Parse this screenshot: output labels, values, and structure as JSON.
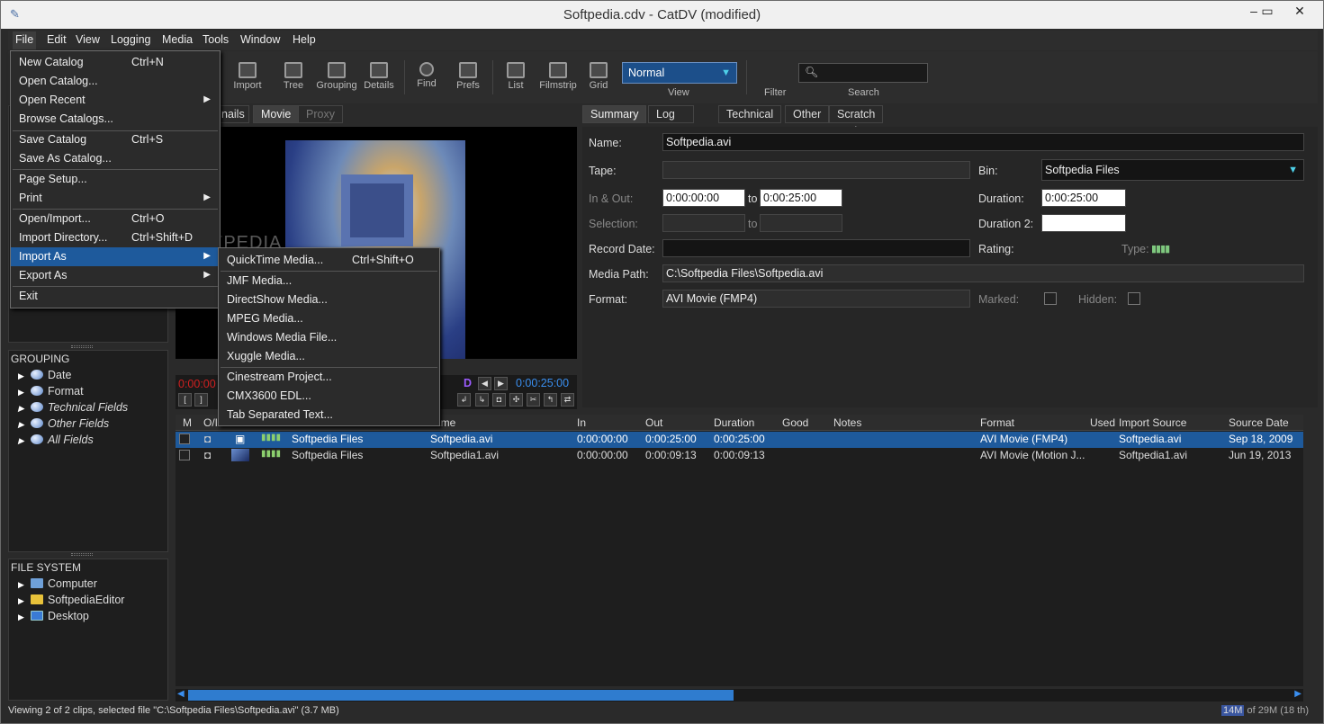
{
  "window": {
    "title": "Softpedia.cdv - CatDV (modified)"
  },
  "menubar": [
    "File",
    "Edit",
    "View",
    "Logging",
    "Media",
    "Tools",
    "Window",
    "Help"
  ],
  "toolbar": {
    "buttons": [
      "Import",
      "Tree",
      "Grouping",
      "Details",
      "Find",
      "Prefs",
      "List",
      "Filmstrip",
      "Grid"
    ],
    "view_label": "View",
    "view_value": "Normal",
    "filter_label": "Filter",
    "search_label": "Search"
  },
  "left": {
    "grouping_header": "GROUPING",
    "grouping_items": [
      "Date",
      "Format",
      "Technical Fields",
      "Other Fields",
      "All Fields"
    ],
    "fs_header": "FILE SYSTEM",
    "fs_items": [
      "Computer",
      "SoftpediaEditor",
      "Desktop"
    ]
  },
  "player": {
    "tabs": [
      "nails",
      "Movie",
      "Proxy"
    ],
    "tc_in": "0:00:00",
    "tc_out": "0:00:25:00",
    "d_mark": "D"
  },
  "details": {
    "tabs": [
      "Summary",
      "Log Notes",
      "Technical",
      "Other",
      "Scratch Pad"
    ],
    "name_label": "Name:",
    "name_value": "Softpedia.avi",
    "tape_label": "Tape:",
    "bin_label": "Bin:",
    "bin_value": "Softpedia Files",
    "inout_label": "In & Out:",
    "in_value": "0:00:00:00",
    "to1": "to",
    "out_value": "0:00:25:00",
    "duration_label": "Duration:",
    "duration_value": "0:00:25:00",
    "selection_label": "Selection:",
    "to2": "to",
    "duration2_label": "Duration 2:",
    "record_label": "Record Date:",
    "rating_label": "Rating:",
    "type_label": "Type:",
    "mediapath_label": "Media Path:",
    "mediapath_value": "C:\\Softpedia Files\\Softpedia.avi",
    "format_label": "Format:",
    "format_value": "AVI Movie (FMP4)",
    "marked_label": "Marked:",
    "hidden_label": "Hidden:"
  },
  "table": {
    "headers": [
      "M",
      "O/I",
      "ame",
      "In",
      "Out",
      "Duration",
      "Good",
      "Notes",
      "Format",
      "Used",
      "Import Source",
      "Source Date"
    ],
    "rows": [
      {
        "bin": "Softpedia Files",
        "name": "Softpedia.avi",
        "in": "0:00:00:00",
        "out": "0:00:25:00",
        "dur": "0:00:25:00",
        "format": "AVI Movie (FMP4)",
        "src": "Softpedia.avi",
        "date": "Sep 18, 2009"
      },
      {
        "bin": "Softpedia Files",
        "name": "Softpedia1.avi",
        "in": "0:00:00:00",
        "out": "0:00:09:13",
        "dur": "0:00:09:13",
        "format": "AVI Movie (Motion J...",
        "src": "Softpedia1.avi",
        "date": "Jun 19, 2013"
      }
    ]
  },
  "status": {
    "text": "Viewing 2 of 2 clips, selected file \"C:\\Softpedia Files\\Softpedia.avi\" (3.7 MB)",
    "mem_used": "14M",
    "mem_rest": "of 29M (18 th)"
  },
  "file_menu": {
    "items": [
      {
        "label": "New Catalog",
        "shortcut": "Ctrl+N"
      },
      {
        "label": "Open Catalog..."
      },
      {
        "label": "Open Recent",
        "sub": true
      },
      {
        "label": "Browse Catalogs..."
      },
      {
        "label": "Save Catalog",
        "shortcut": "Ctrl+S"
      },
      {
        "label": "Save As Catalog..."
      },
      {
        "label": "Page Setup..."
      },
      {
        "label": "Print",
        "sub": true
      },
      {
        "label": "Open/Import...",
        "shortcut": "Ctrl+O"
      },
      {
        "label": "Import Directory...",
        "shortcut": "Ctrl+Shift+D"
      },
      {
        "label": "Import As",
        "sub": true
      },
      {
        "label": "Export As",
        "sub": true
      },
      {
        "label": "Exit"
      }
    ]
  },
  "import_menu": {
    "items": [
      {
        "label": "QuickTime Media...",
        "shortcut": "Ctrl+Shift+O"
      },
      {
        "label": "JMF Media..."
      },
      {
        "label": "DirectShow Media..."
      },
      {
        "label": "MPEG Media..."
      },
      {
        "label": "Windows Media File..."
      },
      {
        "label": "Xuggle Media..."
      },
      {
        "label": "Cinestream Project..."
      },
      {
        "label": "CMX3600 EDL..."
      },
      {
        "label": "Tab Separated Text..."
      }
    ]
  },
  "watermark": "SOFTPEDIA"
}
